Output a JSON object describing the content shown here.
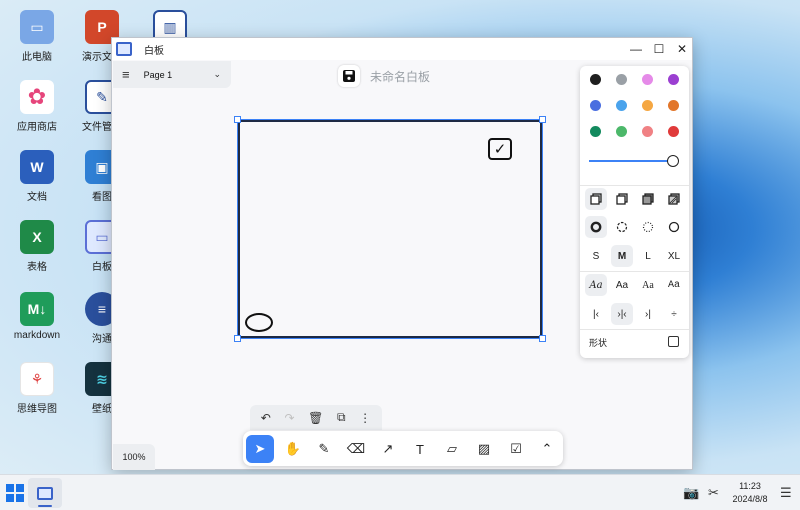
{
  "desktop": {
    "icons": [
      {
        "label": "此电脑",
        "icon": "computer-icon",
        "color": "#7aa7e6"
      },
      {
        "label": "演示文稿",
        "icon": "presentation-icon",
        "color": "#d2472a"
      },
      {
        "label": "",
        "icon": "chart-app-icon",
        "color": "#2a4f9c"
      },
      {
        "label": "应用商店",
        "icon": "app-store-icon",
        "color": "#e6457b"
      },
      {
        "label": "文件管理",
        "icon": "file-manager-icon",
        "color": "#2a4f9c"
      },
      {
        "label": "文档",
        "icon": "word-doc-icon",
        "color": "#2b5fbc"
      },
      {
        "label": "看图",
        "icon": "image-viewer-icon",
        "color": "#2f7fd4"
      },
      {
        "label": "表格",
        "icon": "excel-sheet-icon",
        "color": "#1f8a48"
      },
      {
        "label": "白板",
        "icon": "whiteboard-app-icon",
        "color": "#5b6fd6"
      },
      {
        "label": "markdown",
        "icon": "markdown-icon",
        "color": "#1f9c5a"
      },
      {
        "label": "沟通",
        "icon": "chat-icon",
        "color": "#2a4f9c"
      },
      {
        "label": "思维导图",
        "icon": "mindmap-icon",
        "color": "#e04646"
      },
      {
        "label": "壁纸",
        "icon": "wallpaper-icon",
        "color": "#15323f"
      }
    ]
  },
  "window": {
    "title": "白板",
    "controls": {
      "minimize": "—",
      "maximize": "☐",
      "close": "✕"
    },
    "page_selector": {
      "menu_glyph": "≡",
      "page_name": "Page 1",
      "chevron": "⌄"
    },
    "document_title": "未命名白板",
    "zoom_level": "100%"
  },
  "canvas": {
    "shapes": [
      {
        "type": "rectangle",
        "icon": "rectangle-shape"
      },
      {
        "type": "checkbox",
        "glyph": "✓"
      },
      {
        "type": "ellipse"
      }
    ]
  },
  "style_panel": {
    "colors": [
      "#1f1f1f",
      "#9aa0a6",
      "#e58ae8",
      "#9b3fd1",
      "#4a6ee0",
      "#4aa3ec",
      "#f5a742",
      "#e2762a",
      "#138a5e",
      "#4cb86a",
      "#f08184",
      "#e03a3a"
    ],
    "opacity_value": 1.0,
    "fill_styles": [
      "fill-none-icon",
      "fill-semi-icon",
      "fill-solid-icon",
      "fill-pattern-icon"
    ],
    "dash_styles": [
      "dash-draw-icon",
      "dash-dashed-icon",
      "dash-dotted-icon",
      "dash-solid-icon"
    ],
    "sizes": [
      "S",
      "M",
      "L",
      "XL"
    ],
    "fonts": [
      "Aa",
      "Aa",
      "Aa",
      "Aa"
    ],
    "align": [
      "|‹",
      "›|‹",
      "›|",
      "÷"
    ],
    "geo_label": "形状"
  },
  "action_bar": {
    "undo": "↶",
    "redo": "↷",
    "delete": "🗑",
    "duplicate": "⧉",
    "more": "⋮"
  },
  "toolbar": {
    "tools": [
      {
        "name": "select",
        "glyph": "➤"
      },
      {
        "name": "hand",
        "glyph": "✋"
      },
      {
        "name": "draw",
        "glyph": "✎"
      },
      {
        "name": "eraser",
        "glyph": "⌫"
      },
      {
        "name": "arrow",
        "glyph": "↗"
      },
      {
        "name": "text",
        "glyph": "T"
      },
      {
        "name": "note",
        "glyph": "▱"
      },
      {
        "name": "image",
        "glyph": "▨"
      },
      {
        "name": "checkbox",
        "glyph": "☑"
      },
      {
        "name": "more",
        "glyph": "⌃"
      }
    ]
  },
  "taskbar": {
    "time": "11:23",
    "date": "2024/8/8",
    "tray": {
      "camera": "📷",
      "scissors": "✂",
      "menu": "☰"
    }
  }
}
